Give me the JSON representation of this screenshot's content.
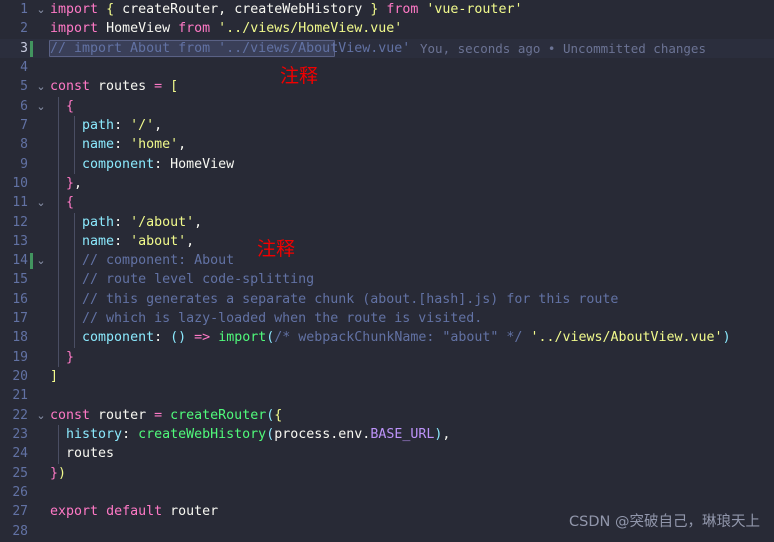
{
  "editor": {
    "theme_name": "dracula",
    "background": "#282a36",
    "active_line_background": "#2b2e3d",
    "gutter_color": "#6272a4",
    "total_visible_lines": 28,
    "active_line": 3,
    "modified_lines": [
      3,
      14
    ]
  },
  "blame": {
    "line": 3,
    "text": "You, seconds ago • Uncommitted changes"
  },
  "annotations": [
    {
      "id": "annot-1",
      "text": "注释",
      "color": "#f10000"
    },
    {
      "id": "annot-2",
      "text": "注释",
      "color": "#f10000"
    }
  ],
  "watermark": {
    "text": "CSDN @突破自己，琳琅天上"
  },
  "lines": [
    {
      "n": "1",
      "text": "import { createRouter, createWebHistory } from 'vue-router'"
    },
    {
      "n": "2",
      "text": "import HomeView from '../views/HomeView.vue'"
    },
    {
      "n": "3",
      "text": "// import About from '../views/AboutView.vue'"
    },
    {
      "n": "4",
      "text": ""
    },
    {
      "n": "5",
      "text": "const routes = ["
    },
    {
      "n": "6",
      "text": "  {"
    },
    {
      "n": "7",
      "text": "    path: '/',"
    },
    {
      "n": "8",
      "text": "    name: 'home',"
    },
    {
      "n": "9",
      "text": "    component: HomeView"
    },
    {
      "n": "10",
      "text": "  },"
    },
    {
      "n": "11",
      "text": "  {"
    },
    {
      "n": "12",
      "text": "    path: '/about',"
    },
    {
      "n": "13",
      "text": "    name: 'about',"
    },
    {
      "n": "14",
      "text": "    // component: About"
    },
    {
      "n": "15",
      "text": "    // route level code-splitting"
    },
    {
      "n": "16",
      "text": "    // this generates a separate chunk (about.[hash].js) for this route"
    },
    {
      "n": "17",
      "text": "    // which is lazy-loaded when the route is visited."
    },
    {
      "n": "18",
      "text": "    component: () => import(/* webpackChunkName: \"about\" */ '../views/AboutView.vue')"
    },
    {
      "n": "19",
      "text": "  }"
    },
    {
      "n": "20",
      "text": "]"
    },
    {
      "n": "21",
      "text": ""
    },
    {
      "n": "22",
      "text": "const router = createRouter({"
    },
    {
      "n": "23",
      "text": "  history: createWebHistory(process.env.BASE_URL),"
    },
    {
      "n": "24",
      "text": "  routes"
    },
    {
      "n": "25",
      "text": "})"
    },
    {
      "n": "26",
      "text": ""
    },
    {
      "n": "27",
      "text": "export default router"
    },
    {
      "n": "28",
      "text": ""
    }
  ],
  "fold_markers": [
    {
      "line": "1",
      "glyph": "⌄"
    },
    {
      "line": "5",
      "glyph": "⌄"
    },
    {
      "line": "6",
      "glyph": "⌄"
    },
    {
      "line": "11",
      "glyph": "⌄"
    },
    {
      "line": "14",
      "glyph": "⌄"
    },
    {
      "line": "22",
      "glyph": "⌄"
    }
  ]
}
